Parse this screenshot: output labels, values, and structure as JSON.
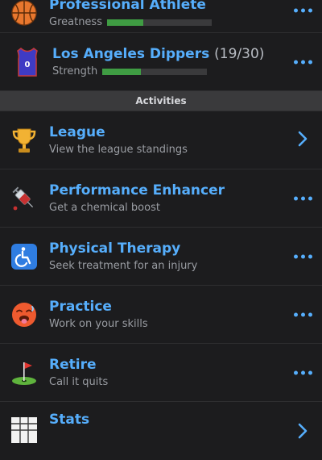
{
  "career": {
    "role": {
      "title": "Professional Athlete",
      "stat_label": "Greatness",
      "stat_level": 0.35,
      "icon": "basketball-icon"
    },
    "team": {
      "name": "Los Angeles Dippers",
      "record": "(19/30)",
      "stat_label": "Strength",
      "stat_level": 0.37,
      "icon": "jersey-icon",
      "jersey_number": "0"
    }
  },
  "activities": {
    "header": "Activities",
    "items": [
      {
        "title": "League",
        "subtitle": "View the league standings",
        "icon": "trophy-icon",
        "action": "chevron"
      },
      {
        "title": "Performance Enhancer",
        "subtitle": "Get a chemical boost",
        "icon": "syringe-icon",
        "action": "more"
      },
      {
        "title": "Physical Therapy",
        "subtitle": "Seek treatment for an injury",
        "icon": "wheelchair-icon",
        "action": "more"
      },
      {
        "title": "Practice",
        "subtitle": "Work on your skills",
        "icon": "hot-face-icon",
        "action": "more"
      },
      {
        "title": "Retire",
        "subtitle": "Call it quits",
        "icon": "golf-flag-icon",
        "action": "more"
      },
      {
        "title": "Stats",
        "subtitle": "",
        "icon": "stats-grid-icon",
        "action": "chevron"
      }
    ]
  },
  "colors": {
    "accent": "#56aefc",
    "bar_fill": "#3f9c43",
    "background": "#1c1c1e"
  }
}
